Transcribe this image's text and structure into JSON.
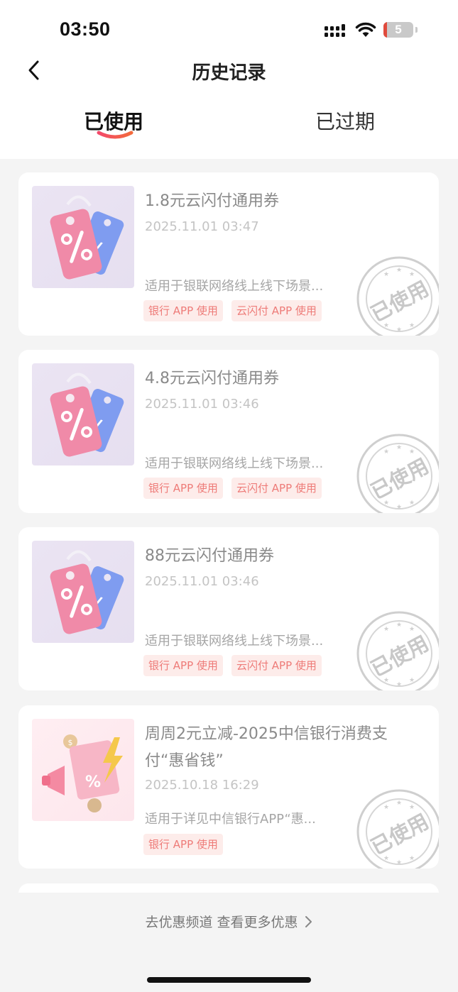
{
  "status_bar": {
    "time": "03:50",
    "battery": "5"
  },
  "header": {
    "title": "历史记录"
  },
  "tabs": [
    {
      "label": "已使用",
      "active": true
    },
    {
      "label": "已过期",
      "active": false
    }
  ],
  "coupons": [
    {
      "title": "1.8元云闪付通用券",
      "time": "2025.11.01 03:47",
      "desc": "适用于银联网络线上线下场景...",
      "tags": [
        "银行 APP 使用",
        "云闪付 APP 使用"
      ],
      "stamp": "已使用"
    },
    {
      "title": "4.8元云闪付通用券",
      "time": "2025.11.01 03:46",
      "desc": "适用于银联网络线上线下场景...",
      "tags": [
        "银行 APP 使用",
        "云闪付 APP 使用"
      ],
      "stamp": "已使用"
    },
    {
      "title": "88元云闪付通用券",
      "time": "2025.11.01 03:46",
      "desc": "适用于银联网络线上线下场景...",
      "tags": [
        "银行 APP 使用",
        "云闪付 APP 使用"
      ],
      "stamp": "已使用"
    },
    {
      "title": "周周2元立减-2025中信银行消费支付“惠省钱”",
      "time": "2025.10.18 16:29",
      "desc": "适用于详见中信银行APP“惠...",
      "tags": [
        "银行 APP 使用"
      ],
      "stamp": "已使用"
    }
  ],
  "footer": {
    "link": "去优惠频道 查看更多优惠"
  },
  "colors": {
    "accent": "#f0463c",
    "tag_bg": "#fdecea",
    "tag_text": "#ee7b78",
    "stamp": "#c8c8c8"
  }
}
